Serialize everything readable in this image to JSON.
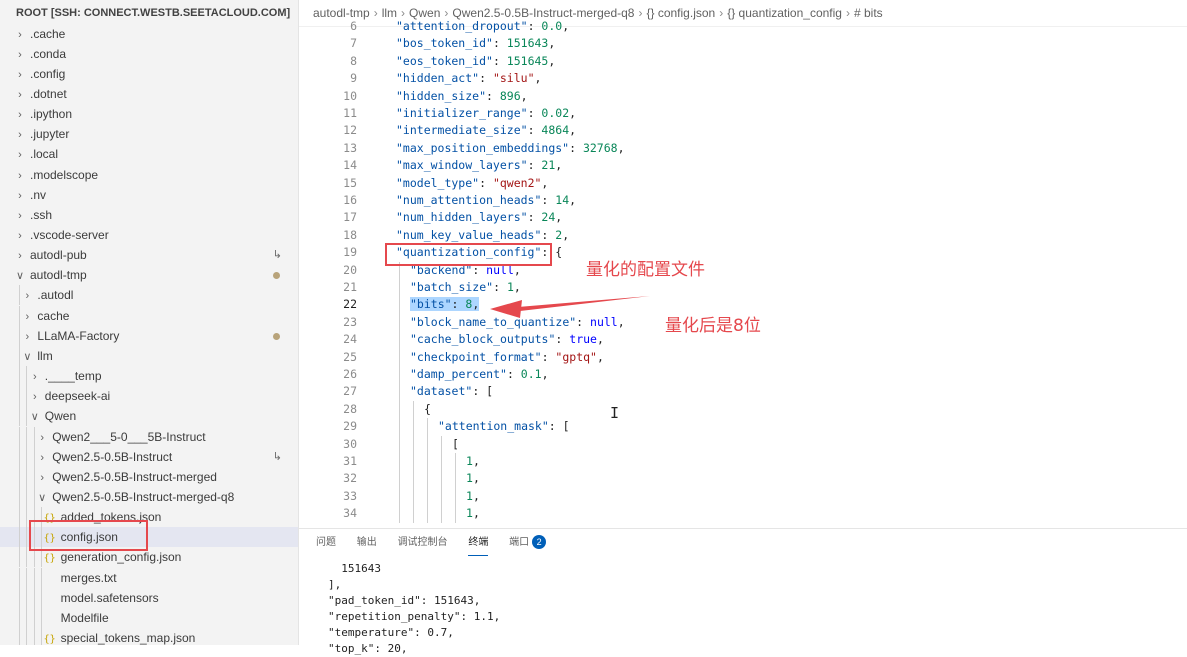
{
  "sidebar": {
    "header": "ROOT [SSH: CONNECT.WESTB.SEETACLOUD.COM]",
    "items": [
      {
        "label": ".cache",
        "type": "folder",
        "expanded": false,
        "depth": 0
      },
      {
        "label": ".conda",
        "type": "folder",
        "expanded": false,
        "depth": 0
      },
      {
        "label": ".config",
        "type": "folder",
        "expanded": false,
        "depth": 0
      },
      {
        "label": ".dotnet",
        "type": "folder",
        "expanded": false,
        "depth": 0
      },
      {
        "label": ".ipython",
        "type": "folder",
        "expanded": false,
        "depth": 0
      },
      {
        "label": ".jupyter",
        "type": "folder",
        "expanded": false,
        "depth": 0
      },
      {
        "label": ".local",
        "type": "folder",
        "expanded": false,
        "depth": 0
      },
      {
        "label": ".modelscope",
        "type": "folder",
        "expanded": false,
        "depth": 0
      },
      {
        "label": ".nv",
        "type": "folder",
        "expanded": false,
        "depth": 0
      },
      {
        "label": ".ssh",
        "type": "folder",
        "expanded": false,
        "depth": 0
      },
      {
        "label": ".vscode-server",
        "type": "folder",
        "expanded": false,
        "depth": 0
      },
      {
        "label": "autodl-pub",
        "type": "folder",
        "expanded": false,
        "depth": 0,
        "badge": "link"
      },
      {
        "label": "autodl-tmp",
        "type": "folder",
        "expanded": true,
        "depth": 0,
        "badge": "dot"
      },
      {
        "label": ".autodl",
        "type": "folder",
        "expanded": false,
        "depth": 1
      },
      {
        "label": "cache",
        "type": "folder",
        "expanded": false,
        "depth": 1
      },
      {
        "label": "LLaMA-Factory",
        "type": "folder",
        "expanded": false,
        "depth": 1,
        "badge": "dot"
      },
      {
        "label": "llm",
        "type": "folder",
        "expanded": true,
        "depth": 1
      },
      {
        "label": ".____temp",
        "type": "folder",
        "expanded": false,
        "depth": 2
      },
      {
        "label": "deepseek-ai",
        "type": "folder",
        "expanded": false,
        "depth": 2
      },
      {
        "label": "Qwen",
        "type": "folder",
        "expanded": true,
        "depth": 2
      },
      {
        "label": "Qwen2___5-0___5B-Instruct",
        "type": "folder",
        "expanded": false,
        "depth": 3
      },
      {
        "label": "Qwen2.5-0.5B-Instruct",
        "type": "folder",
        "expanded": false,
        "depth": 3,
        "badge": "link"
      },
      {
        "label": "Qwen2.5-0.5B-Instruct-merged",
        "type": "folder",
        "expanded": false,
        "depth": 3
      },
      {
        "label": "Qwen2.5-0.5B-Instruct-merged-q8",
        "type": "folder",
        "expanded": true,
        "depth": 3
      },
      {
        "label": "added_tokens.json",
        "type": "json",
        "depth": 4
      },
      {
        "label": "config.json",
        "type": "json",
        "depth": 4,
        "selected": true
      },
      {
        "label": "generation_config.json",
        "type": "json",
        "depth": 4
      },
      {
        "label": "merges.txt",
        "type": "file",
        "depth": 4
      },
      {
        "label": "model.safetensors",
        "type": "file",
        "depth": 4
      },
      {
        "label": "Modelfile",
        "type": "file",
        "depth": 4
      },
      {
        "label": "special_tokens_map.json",
        "type": "json",
        "depth": 4
      }
    ]
  },
  "breadcrumb": [
    "autodl-tmp",
    "llm",
    "Qwen",
    "Qwen2.5-0.5B-Instruct-merged-q8",
    "{} config.json",
    "{} quantization_config",
    "# bits"
  ],
  "editor": {
    "active_line": 22,
    "lines": [
      {
        "n": "6",
        "indent": 0,
        "key": "\"attention_dropout\"",
        "value": "0.0",
        "vtype": "n",
        "tail": ","
      },
      {
        "n": "7",
        "indent": 0,
        "key": "\"bos_token_id\"",
        "value": "151643",
        "vtype": "n",
        "tail": ","
      },
      {
        "n": "8",
        "indent": 0,
        "key": "\"eos_token_id\"",
        "value": "151645",
        "vtype": "n",
        "tail": ","
      },
      {
        "n": "9",
        "indent": 0,
        "key": "\"hidden_act\"",
        "value": "\"silu\"",
        "vtype": "s",
        "tail": ","
      },
      {
        "n": "10",
        "indent": 0,
        "key": "\"hidden_size\"",
        "value": "896",
        "vtype": "n",
        "tail": ","
      },
      {
        "n": "11",
        "indent": 0,
        "key": "\"initializer_range\"",
        "value": "0.02",
        "vtype": "n",
        "tail": ","
      },
      {
        "n": "12",
        "indent": 0,
        "key": "\"intermediate_size\"",
        "value": "4864",
        "vtype": "n",
        "tail": ","
      },
      {
        "n": "13",
        "indent": 0,
        "key": "\"max_position_embeddings\"",
        "value": "32768",
        "vtype": "n",
        "tail": ","
      },
      {
        "n": "14",
        "indent": 0,
        "key": "\"max_window_layers\"",
        "value": "21",
        "vtype": "n",
        "tail": ","
      },
      {
        "n": "15",
        "indent": 0,
        "key": "\"model_type\"",
        "value": "\"qwen2\"",
        "vtype": "s",
        "tail": ","
      },
      {
        "n": "16",
        "indent": 0,
        "key": "\"num_attention_heads\"",
        "value": "14",
        "vtype": "n",
        "tail": ","
      },
      {
        "n": "17",
        "indent": 0,
        "key": "\"num_hidden_layers\"",
        "value": "24",
        "vtype": "n",
        "tail": ","
      },
      {
        "n": "18",
        "indent": 0,
        "key": "\"num_key_value_heads\"",
        "value": "2",
        "vtype": "n",
        "tail": ","
      },
      {
        "n": "19",
        "indent": 0,
        "key": "\"quantization_config\"",
        "value": "{",
        "vtype": "p",
        "tail": ""
      },
      {
        "n": "20",
        "indent": 1,
        "key": "\"backend\"",
        "value": "null",
        "vtype": "b",
        "tail": ","
      },
      {
        "n": "21",
        "indent": 1,
        "key": "\"batch_size\"",
        "value": "1",
        "vtype": "n",
        "tail": ","
      },
      {
        "n": "22",
        "indent": 1,
        "key": "\"bits\"",
        "value": "8",
        "vtype": "n",
        "tail": ",",
        "selected": true
      },
      {
        "n": "23",
        "indent": 1,
        "key": "\"block_name_to_quantize\"",
        "value": "null",
        "vtype": "b",
        "tail": ","
      },
      {
        "n": "24",
        "indent": 1,
        "key": "\"cache_block_outputs\"",
        "value": "true",
        "vtype": "b",
        "tail": ","
      },
      {
        "n": "25",
        "indent": 1,
        "key": "\"checkpoint_format\"",
        "value": "\"gptq\"",
        "vtype": "s",
        "tail": ","
      },
      {
        "n": "26",
        "indent": 1,
        "key": "\"damp_percent\"",
        "value": "0.1",
        "vtype": "n",
        "tail": ","
      },
      {
        "n": "27",
        "indent": 1,
        "key": "\"dataset\"",
        "value": "[",
        "vtype": "p",
        "tail": ""
      },
      {
        "n": "28",
        "indent": 2,
        "key": "",
        "value": "{",
        "vtype": "p",
        "tail": ""
      },
      {
        "n": "29",
        "indent": 3,
        "key": "\"attention_mask\"",
        "value": "[",
        "vtype": "p",
        "tail": ""
      },
      {
        "n": "30",
        "indent": 4,
        "key": "",
        "value": "[",
        "vtype": "p",
        "tail": ""
      },
      {
        "n": "31",
        "indent": 5,
        "key": "",
        "value": "1",
        "vtype": "n",
        "tail": ","
      },
      {
        "n": "32",
        "indent": 5,
        "key": "",
        "value": "1",
        "vtype": "n",
        "tail": ","
      },
      {
        "n": "33",
        "indent": 5,
        "key": "",
        "value": "1",
        "vtype": "n",
        "tail": ","
      },
      {
        "n": "34",
        "indent": 5,
        "key": "",
        "value": "1",
        "vtype": "n",
        "tail": ","
      }
    ]
  },
  "annotations": {
    "quant_config": "量化的配置文件",
    "bits_note": "量化后是8位"
  },
  "panel": {
    "tabs": [
      "问题",
      "输出",
      "调试控制台",
      "终端",
      "端口"
    ],
    "active_tab": "终端",
    "ports_count": "2",
    "terminal_lines": [
      "  151643",
      "],",
      "\"pad_token_id\": 151643,",
      "\"repetition_penalty\": 1.1,",
      "\"temperature\": 0.7,",
      "\"top_k\": 20,"
    ]
  },
  "colors": {
    "annotation_red": "#e5484d",
    "accent_blue": "#005fb8",
    "selection": "#add6ff"
  }
}
